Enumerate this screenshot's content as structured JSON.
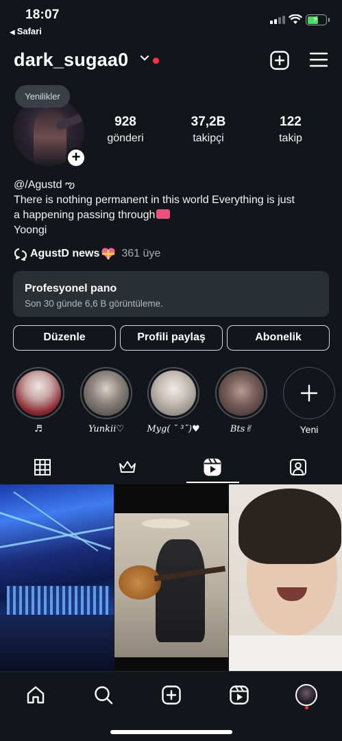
{
  "status_bar": {
    "time": "18:07",
    "back_app": "Safari"
  },
  "header": {
    "username": "dark_sugaa0"
  },
  "profile": {
    "note_bubble": "Yenilikler",
    "stats": [
      {
        "value": "928",
        "label": "gönderi"
      },
      {
        "value": "37,2B",
        "label": "takipçi"
      },
      {
        "value": "122",
        "label": "takip"
      }
    ],
    "bio": {
      "handle": "@/Agustd ఌ",
      "line1": "There is nothing permanent in this world Everything is just",
      "line2": "a happening passing through",
      "line3": "Yoongi"
    },
    "channel": {
      "name": "AgustD news",
      "members": "361 üye"
    }
  },
  "dashboard": {
    "title": "Profesyonel pano",
    "subtitle": "Son 30 günde 6,6 B görüntüleme."
  },
  "buttons": {
    "edit": "Düzenle",
    "share": "Profili paylaş",
    "subscription": "Abonelik"
  },
  "highlights": [
    {
      "caption": "♬"
    },
    {
      "caption": "Yunkii♡"
    },
    {
      "caption": "Myg( ˘ ³˘)♥"
    },
    {
      "caption": "Bts✌︎"
    }
  ],
  "new_highlight": "Yeni",
  "colors": {
    "background": "#12161b",
    "accent_red": "#ff3040",
    "card": "#2a2f36",
    "muted_text": "#a8adb4"
  },
  "icons": {
    "tabs": [
      "grid-icon",
      "crown-icon",
      "reels-icon",
      "tagged-icon"
    ],
    "nav": [
      "home-icon",
      "search-icon",
      "create-icon",
      "reels-icon",
      "profile-avatar"
    ]
  },
  "active_tab": "reels"
}
